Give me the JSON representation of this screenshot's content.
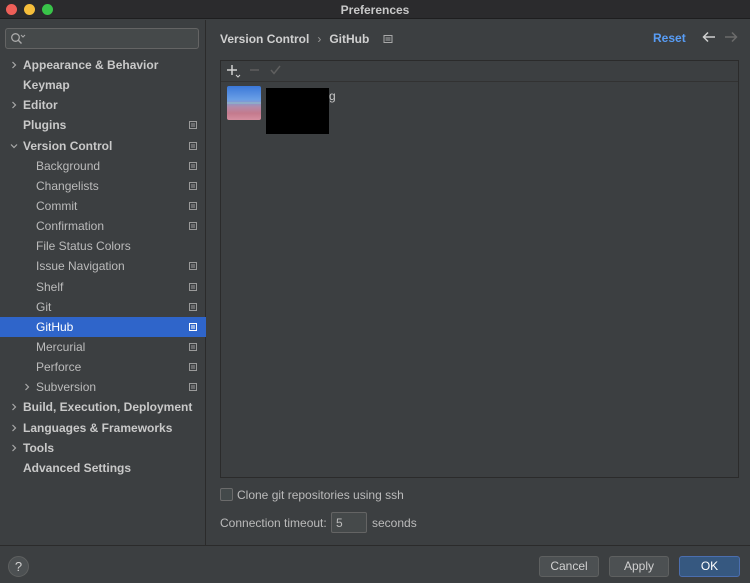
{
  "window": {
    "title": "Preferences"
  },
  "search": {
    "placeholder": ""
  },
  "sidebar": {
    "items": [
      {
        "label": "Appearance & Behavior",
        "level": 0,
        "expandable": true,
        "expanded": false,
        "page_icon": false
      },
      {
        "label": "Keymap",
        "level": 0,
        "expandable": false,
        "page_icon": false
      },
      {
        "label": "Editor",
        "level": 0,
        "expandable": true,
        "expanded": false,
        "page_icon": false
      },
      {
        "label": "Plugins",
        "level": 0,
        "expandable": false,
        "page_icon": true
      },
      {
        "label": "Version Control",
        "level": 0,
        "expandable": true,
        "expanded": true,
        "page_icon": true
      },
      {
        "label": "Background",
        "level": 1,
        "expandable": false,
        "page_icon": true
      },
      {
        "label": "Changelists",
        "level": 1,
        "expandable": false,
        "page_icon": true
      },
      {
        "label": "Commit",
        "level": 1,
        "expandable": false,
        "page_icon": true
      },
      {
        "label": "Confirmation",
        "level": 1,
        "expandable": false,
        "page_icon": true
      },
      {
        "label": "File Status Colors",
        "level": 1,
        "expandable": false,
        "page_icon": false
      },
      {
        "label": "Issue Navigation",
        "level": 1,
        "expandable": false,
        "page_icon": true
      },
      {
        "label": "Shelf",
        "level": 1,
        "expandable": false,
        "page_icon": true
      },
      {
        "label": "Git",
        "level": 1,
        "expandable": false,
        "page_icon": true
      },
      {
        "label": "GitHub",
        "level": 1,
        "expandable": false,
        "page_icon": true,
        "selected": true
      },
      {
        "label": "Mercurial",
        "level": 1,
        "expandable": false,
        "page_icon": true
      },
      {
        "label": "Perforce",
        "level": 1,
        "expandable": false,
        "page_icon": true
      },
      {
        "label": "Subversion",
        "level": 1,
        "expandable": true,
        "expanded": false,
        "page_icon": true
      },
      {
        "label": "Build, Execution, Deployment",
        "level": 0,
        "expandable": true,
        "expanded": false,
        "page_icon": false
      },
      {
        "label": "Languages & Frameworks",
        "level": 0,
        "expandable": true,
        "expanded": false,
        "page_icon": false
      },
      {
        "label": "Tools",
        "level": 0,
        "expandable": true,
        "expanded": false,
        "page_icon": false
      },
      {
        "label": "Advanced Settings",
        "level": 0,
        "expandable": false,
        "page_icon": false
      }
    ]
  },
  "breadcrumb": {
    "parent": "Version Control",
    "separator": "›",
    "current": "GitHub"
  },
  "header": {
    "reset_label": "Reset"
  },
  "accounts": {
    "account_suffix": "g"
  },
  "options": {
    "clone_ssh_label": "Clone git repositories using ssh",
    "clone_ssh_checked": false,
    "timeout_label": "Connection timeout:",
    "timeout_value": "5",
    "timeout_unit": "seconds"
  },
  "footer": {
    "help_label": "?",
    "cancel_label": "Cancel",
    "apply_label": "Apply",
    "ok_label": "OK"
  },
  "colors": {
    "background": "#3c3f41",
    "selection": "#2f65ca",
    "link": "#589df6",
    "ok_button": "#365880"
  }
}
